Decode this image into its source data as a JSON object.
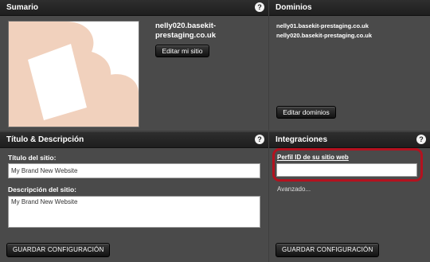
{
  "summary": {
    "header": "Sumario",
    "site_name": "nelly020.basekit-prestaging.co.uk",
    "edit_site_label": "Editar mi sitio"
  },
  "domains": {
    "header": "Dominios",
    "items": [
      "nelly01.basekit-prestaging.co.uk",
      "nelly020.basekit-prestaging.co.uk"
    ],
    "edit_domains_label": "Editar dominios"
  },
  "title_desc": {
    "header": "Título & Descripción",
    "title_label": "Título del sitio:",
    "title_value": "My Brand New Website",
    "desc_label": "Descripción del sitio:",
    "desc_value": "My Brand New Website",
    "save_label": "GUARDAR CONFIGURACIÓN"
  },
  "integrations": {
    "header": "Integraciones",
    "profile_label": "Perfil ID de su sitio web",
    "profile_value": "",
    "advanced_label": "Avanzado...",
    "save_label": "GUARDAR CONFIGURACIÓN"
  },
  "help_glyph": "?",
  "colors": {
    "background": "#3f3f3f",
    "panel": "#4a4a4a",
    "header": "#222222",
    "highlight": "#b3121f",
    "logo": "#f1d1bd"
  }
}
